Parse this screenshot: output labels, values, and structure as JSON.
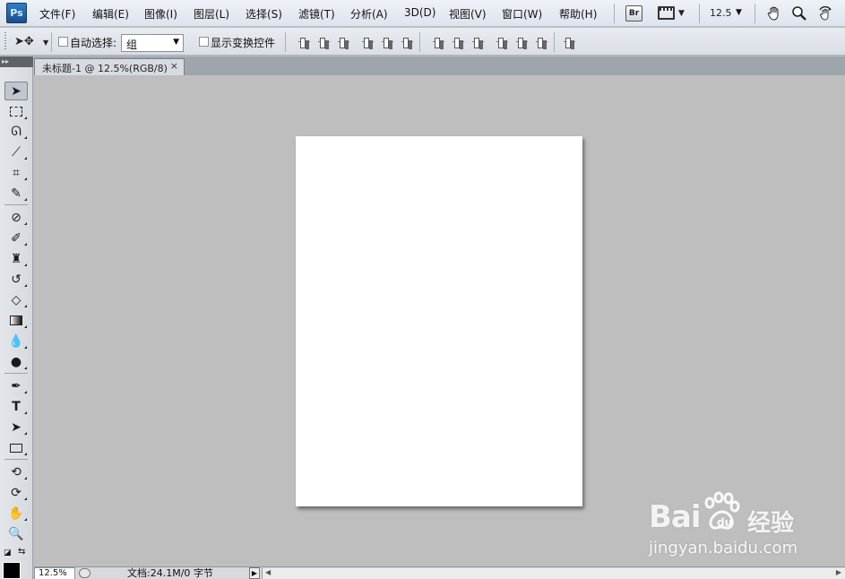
{
  "menubar": {
    "logo": "Ps",
    "items": [
      "文件(F)",
      "编辑(E)",
      "图像(I)",
      "图层(L)",
      "选择(S)",
      "滤镜(T)",
      "分析(A)",
      "3D(D)",
      "视图(V)",
      "窗口(W)",
      "帮助(H)"
    ],
    "bridge_label": "Br",
    "zoom": "12.5",
    "icons": [
      "bridge-icon",
      "mini-bridge-icon",
      "hand-icon",
      "zoom-icon",
      "rotate-view-icon"
    ]
  },
  "options": {
    "tool_icon": "move-tool-icon",
    "auto_select_label": "自动选择:",
    "auto_select_value": "组",
    "show_transform_label": "显示变换控件"
  },
  "tabs": [
    {
      "title": "未标题-1 @ 12.5%(RGB/8)",
      "close": "×"
    }
  ],
  "tools": [
    "move-tool",
    "marquee-tool",
    "lasso-tool",
    "magic-wand-tool",
    "crop-tool",
    "eyedropper-tool",
    "healing-brush-tool",
    "brush-tool",
    "clone-stamp-tool",
    "history-brush-tool",
    "eraser-tool",
    "gradient-tool",
    "blur-tool",
    "dodge-tool",
    "pen-tool",
    "type-tool",
    "path-selection-tool",
    "rectangle-tool",
    "3d-rotate-tool",
    "3d-orbit-tool",
    "hand-tool",
    "zoom-tool"
  ],
  "colors": {
    "foreground": "#000000",
    "background": "#ffffff",
    "canvas_bg": "#bebebe",
    "document": "#ffffff"
  },
  "status": {
    "zoom": "12.5%",
    "doc_info": "文档:24.1M/0 字节"
  },
  "watermark": {
    "brand": "Bai",
    "brand_suffix": "经验",
    "url": "jingyan.baidu.com"
  }
}
